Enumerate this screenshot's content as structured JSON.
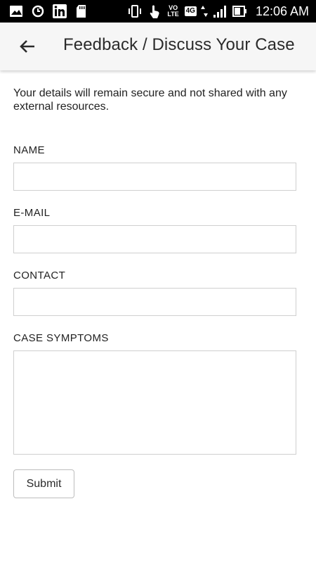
{
  "status_bar": {
    "time": "12:06 AM",
    "lte_label": "VO\nLTE",
    "network_label": "4G",
    "left_icons": [
      "gallery-icon",
      "sync-icon",
      "linkedin-icon",
      "sd-card-icon"
    ],
    "right_icons": [
      "vibrate-icon",
      "touch-icon",
      "volte-icon",
      "4g-icon",
      "data-arrows-icon",
      "signal-icon",
      "battery-icon"
    ]
  },
  "app_bar": {
    "back_icon": "arrow-back-icon",
    "title": "Feedback / Discuss Your Case",
    "background": "#f6f6f6"
  },
  "form": {
    "intro": "Your details will remain secure and not shared with any external resources.",
    "fields": [
      {
        "label": "NAME",
        "value": "",
        "placeholder": ""
      },
      {
        "label": "E-MAIL",
        "value": "",
        "placeholder": ""
      },
      {
        "label": "CONTACT",
        "value": "",
        "placeholder": ""
      },
      {
        "label": "CASE SYMPTOMS",
        "value": "",
        "placeholder": ""
      }
    ],
    "submit_label": "Submit"
  },
  "colors": {
    "status_bar": "#000000",
    "text": "#222222",
    "input_border": "#cfcfcf"
  }
}
